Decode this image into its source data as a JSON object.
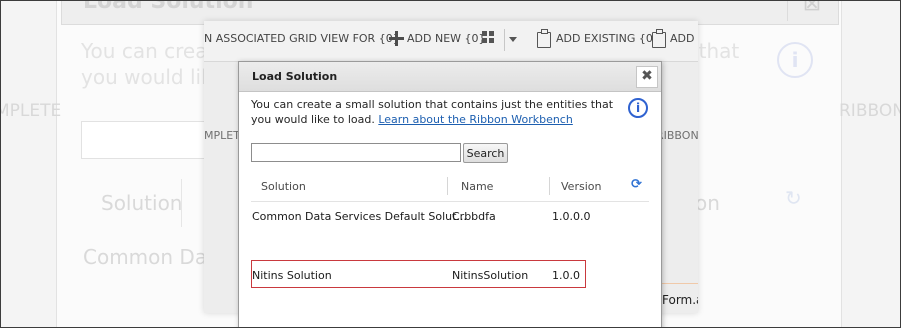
{
  "background": {
    "title": "Load Solution",
    "close_glyph": "⊠",
    "description": "You can create a small solution that contains just the entities that you would like to load.",
    "info_glyph": "i",
    "side_left": "MPLETE",
    "side_right": "RIBBON",
    "col_solution": "Solution",
    "col_on": "on",
    "refresh_glyph": "↻",
    "row": "Common Dat"
  },
  "toolbar": {
    "associated_grid": "N ASSOCIATED GRID VIEW FOR {0}",
    "add_new": "ADD NEW {0}",
    "add_existing": "ADD EXISTING {0}",
    "add_cut": "ADD E"
  },
  "midlayer": {
    "side_left": "MPLET",
    "side_right": "RIBBON.",
    "form_text": "Form.a"
  },
  "dialog": {
    "title": "Load Solution",
    "close_glyph": "✖",
    "description": "You can create a small solution that contains just the entities that you would like to load.",
    "link": "Learn about the Ribbon Workbench",
    "info_glyph": "i",
    "search_value": "",
    "search_placeholder": "",
    "search_button": "Search",
    "columns": {
      "solution": "Solution",
      "name": "Name",
      "version": "Version"
    },
    "refresh_glyph": "⟳",
    "rows": [
      {
        "solution": "Common Data Services Default Solut...",
        "name": "Crbbdfa",
        "version": "1.0.0.0"
      },
      {
        "solution": "Nitins Solution",
        "name": "NitinsSolution",
        "version": "1.0.0"
      }
    ]
  },
  "colors": {
    "accent_blue": "#2f62d0",
    "link_blue": "#1d5fb0",
    "highlight_red": "#c9393e"
  }
}
